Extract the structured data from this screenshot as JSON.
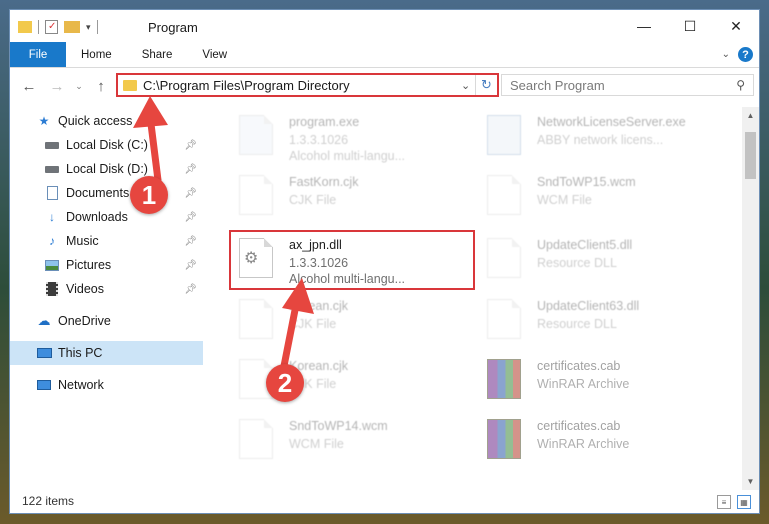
{
  "window": {
    "title": "Program",
    "controls": {
      "minimize": "—",
      "maximize": "☐",
      "close": "✕"
    }
  },
  "ribbon": {
    "tabs": [
      "File",
      "Home",
      "Share",
      "View"
    ]
  },
  "address": {
    "path": "C:\\Program Files\\Program Directory",
    "search_placeholder": "Search Program"
  },
  "sidebar": {
    "items": [
      {
        "label": "Quick access",
        "icon": "star-icon"
      },
      {
        "label": "Local Disk (C:)",
        "icon": "drive-icon",
        "pinned": true
      },
      {
        "label": "Local Disk (D:)",
        "icon": "drive-icon",
        "pinned": true
      },
      {
        "label": "Documents",
        "icon": "documents-icon",
        "pinned": true
      },
      {
        "label": "Downloads",
        "icon": "download-icon",
        "pinned": true
      },
      {
        "label": "Music",
        "icon": "music-icon",
        "pinned": true
      },
      {
        "label": "Pictures",
        "icon": "pictures-icon",
        "pinned": true
      },
      {
        "label": "Videos",
        "icon": "videos-icon",
        "pinned": true
      },
      {
        "label": "OneDrive",
        "icon": "cloud-icon"
      },
      {
        "label": "This PC",
        "icon": "computer-icon",
        "selected": true
      },
      {
        "label": "Network",
        "icon": "network-icon"
      }
    ]
  },
  "files": [
    {
      "name": "program.exe",
      "line2": "1.3.3.1026",
      "line3": "Alcohol multi-langu...",
      "kind": "exe"
    },
    {
      "name": "NetworkLicenseServer.exe",
      "line2": "ABBY network licens...",
      "line3": "",
      "kind": "exe"
    },
    {
      "name": "FastKorn.cjk",
      "line2": "CJK File",
      "line3": "",
      "kind": "doc"
    },
    {
      "name": "SndToWP15.wcm",
      "line2": "WCM File",
      "line3": "",
      "kind": "doc"
    },
    {
      "name": "ax_jpn.dll",
      "line2": "1.3.3.1026",
      "line3": "Alcohol multi-langu...",
      "kind": "dll"
    },
    {
      "name": "UpdateClient5.dll",
      "line2": "Resource DLL",
      "line3": "",
      "kind": "dll"
    },
    {
      "name": "Korean.cjk",
      "line2": "CJK File",
      "line3": "",
      "kind": "doc"
    },
    {
      "name": "UpdateClient63.dll",
      "line2": "Resource DLL",
      "line3": "",
      "kind": "dll"
    },
    {
      "name": "Korean.cjk",
      "line2": "CJK File",
      "line3": "",
      "kind": "doc"
    },
    {
      "name": "certificates.cab",
      "line2": "WinRAR Archive",
      "line3": "",
      "kind": "rar"
    },
    {
      "name": "SndToWP14.wcm",
      "line2": "WCM File",
      "line3": "",
      "kind": "doc"
    },
    {
      "name": "certificates.cab",
      "line2": "WinRAR Archive",
      "line3": "",
      "kind": "rar"
    }
  ],
  "status": {
    "item_count": "122 items"
  },
  "annotations": {
    "step1": "1",
    "step2": "2"
  },
  "colors": {
    "accent": "#1979ca",
    "highlight": "#d9363a",
    "badge": "#e6463f"
  }
}
